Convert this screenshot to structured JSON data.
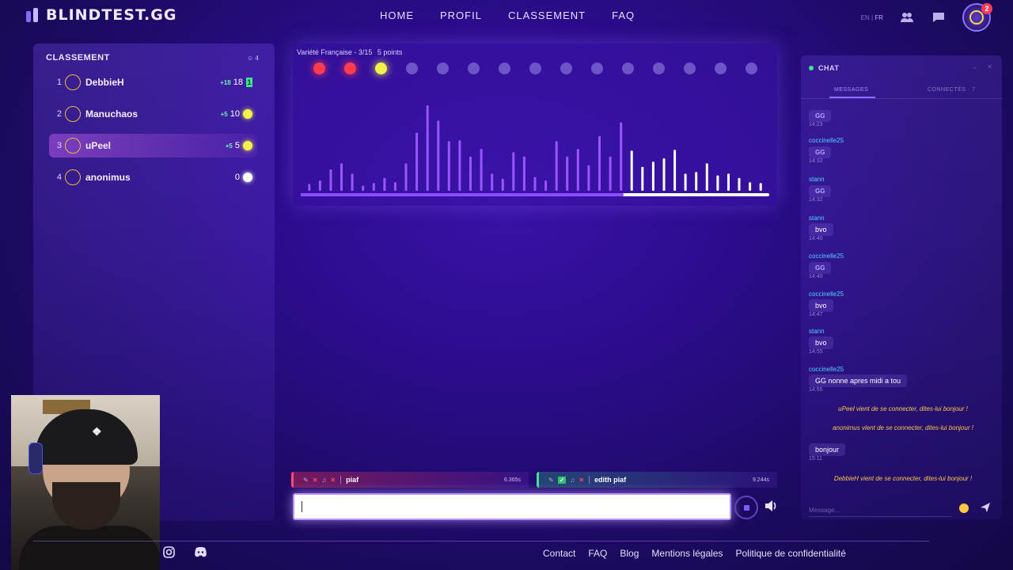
{
  "header": {
    "logo_text": "BLINDTEST.GG",
    "nav": [
      "HOME",
      "PROFIL",
      "CLASSEMENT",
      "FAQ"
    ],
    "lang_en": "EN",
    "lang_sep": "|",
    "lang_fr": "FR",
    "notification_count": "2"
  },
  "ranking": {
    "title": "CLASSEMENT",
    "player_count": "4",
    "players": [
      {
        "rank": "1",
        "name": "DebbieH",
        "delta": "+18",
        "score": "18",
        "indicator": "flag",
        "indicator_text": "1",
        "active": false
      },
      {
        "rank": "2",
        "name": "Manuchaos",
        "delta": "+5",
        "score": "10",
        "indicator": "dot",
        "dot_color": "#f2f04a",
        "active": false
      },
      {
        "rank": "3",
        "name": "uPeel",
        "delta": "+5",
        "score": "5",
        "indicator": "dot",
        "dot_color": "#f2f04a",
        "active": true
      },
      {
        "rank": "4",
        "name": "anonimus",
        "delta": "",
        "score": "0",
        "indicator": "dot",
        "dot_color": "#ffffff",
        "active": false
      }
    ]
  },
  "game": {
    "playlist": "Variété Française - 3/15",
    "points": "5 points",
    "rounds": [
      "#ff3b4f",
      "#ff3b4f",
      "#f4f04a",
      "#6d55c8",
      "#6d55c8",
      "#6d55c8",
      "#6d55c8",
      "#6d55c8",
      "#6d55c8",
      "#6d55c8",
      "#6d55c8",
      "#6d55c8",
      "#6d55c8",
      "#6d55c8",
      "#6d55c8"
    ],
    "progress": 0.69,
    "spectrum": [
      0.08,
      0.12,
      0.25,
      0.32,
      0.2,
      0.06,
      0.09,
      0.15,
      0.1,
      0.32,
      0.68,
      1.0,
      0.82,
      0.58,
      0.59,
      0.4,
      0.49,
      0.2,
      0.14,
      0.45,
      0.4,
      0.16,
      0.12,
      0.58,
      0.4,
      0.49,
      0.3,
      0.64,
      0.4,
      0.8,
      0.47,
      0.28,
      0.34,
      0.38,
      0.48,
      0.2,
      0.22,
      0.32,
      0.18,
      0.2,
      0.15,
      0.1,
      0.09
    ]
  },
  "answers": [
    {
      "text": "piaf",
      "time": "6.365s",
      "correct": false
    },
    {
      "text": "edith piaf",
      "time": "9.244s",
      "correct": true
    }
  ],
  "chat": {
    "title": "CHAT",
    "tab_messages": "MESSAGES",
    "tab_connected": "CONNECTÉS · 7",
    "input_placeholder": "Message...",
    "messages": [
      {
        "user": "",
        "text": "GG",
        "time": "14:23",
        "gg": true
      },
      {
        "user": "coccinelle25",
        "text": "GG",
        "time": "14:32",
        "gg": true
      },
      {
        "user": "stann",
        "text": "GG",
        "time": "14:32",
        "gg": true
      },
      {
        "user": "stann",
        "text": "bvo",
        "time": "14:40",
        "gg": false
      },
      {
        "user": "coccinelle25",
        "text": "GG",
        "time": "14:40",
        "gg": true
      },
      {
        "user": "coccinelle25",
        "text": "bvo",
        "time": "14:47",
        "gg": false
      },
      {
        "user": "stann",
        "text": "bvo",
        "time": "14:55",
        "gg": false
      },
      {
        "user": "coccinelle25",
        "text": "GG nonne apres midi a tou",
        "time": "14:55",
        "gg": false
      }
    ],
    "system_1": "uPeel vient de se connecter, dites-lui bonjour !",
    "system_2": "anonimus vient de se connecter, dites-lui bonjour !",
    "own_message": "bonjour",
    "own_time": "15:11",
    "system_3": "DebbieH vient de se connecter, dites-lui bonjour !"
  },
  "footer": {
    "links": [
      "Contact",
      "FAQ",
      "Blog",
      "Mentions légales",
      "Politique de confidentialité"
    ]
  },
  "colors": {
    "accent": "#8a4dff",
    "correct": "#3de58f",
    "wrong": "#ff4b6e",
    "chat_user": "#51d2ff",
    "system_msg": "#ffc54a"
  }
}
